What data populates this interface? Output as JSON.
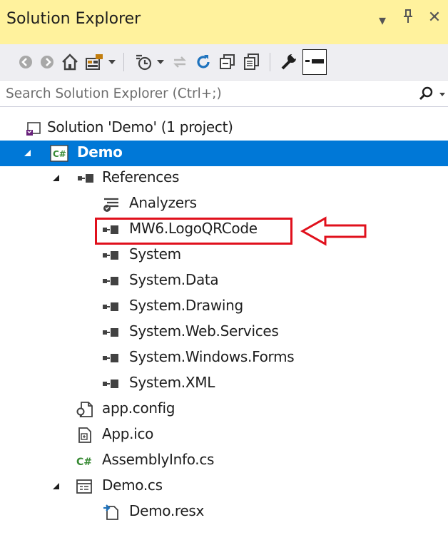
{
  "panel": {
    "title": "Solution Explorer",
    "dropdown_glyph": "▾",
    "pin_glyph": "ᛰ",
    "close_glyph": "✕"
  },
  "toolbar": {
    "buttons": [
      "back-icon",
      "forward-icon",
      "home-icon",
      "switch-views-icon",
      "pending-changes-icon",
      "sync-icon",
      "refresh-icon",
      "collapse-all-icon",
      "show-all-files-icon",
      "properties-icon",
      "preview-icon"
    ]
  },
  "search": {
    "placeholder": "Search Solution Explorer (Ctrl+;)"
  },
  "tree": {
    "solution": "Solution 'Demo' (1 project)",
    "project": "Demo",
    "references": "References",
    "items": [
      "Analyzers",
      "MW6.LogoQRCode",
      "System",
      "System.Data",
      "System.Drawing",
      "System.Web.Services",
      "System.Windows.Forms",
      "System.XML"
    ],
    "app_config": "app.config",
    "app_ico": "App.ico",
    "assembly_info": "AssemblyInfo.cs",
    "demo_cs": "Demo.cs",
    "demo_resx": "Demo.resx"
  },
  "colors": {
    "titlebar": "#fff29d",
    "selection": "#0078d7",
    "highlight": "#e0101c",
    "csharp_green": "#388a34"
  }
}
